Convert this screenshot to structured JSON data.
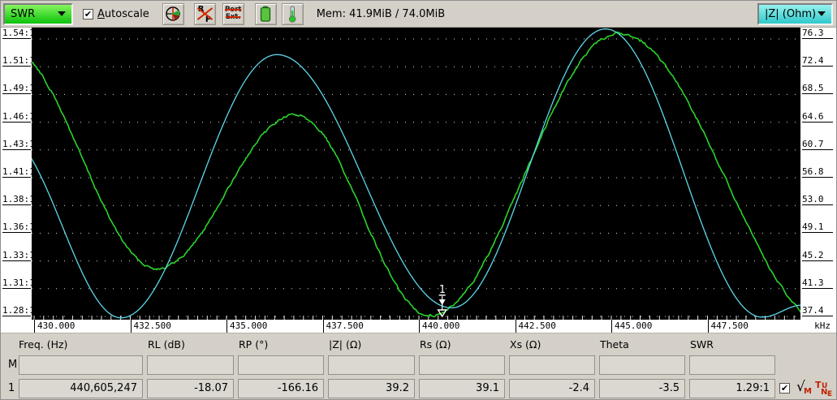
{
  "toolbar": {
    "trace_select_value": "SWR",
    "autoscale_label": "Autoscale",
    "rf_letters": [
      "R",
      "F"
    ],
    "port_ext_lines": [
      "Port",
      "Ext."
    ],
    "mem_text": "Mem: 41.9MiB / 74.0MiB",
    "imp_select_value": "|Z| (Ohm)"
  },
  "chart_data": {
    "type": "line",
    "background": "#000000",
    "grid": "dotted-horizontal",
    "x_axis": {
      "unit_label": "kHz",
      "tick_labels": [
        "430.000",
        "432.500",
        "435.000",
        "437.500",
        "440.000",
        "442.500",
        "445.000",
        "447.500"
      ],
      "tick_values": [
        430,
        432.5,
        435,
        437.5,
        440,
        442.5,
        445,
        447.5
      ],
      "range": [
        429.93,
        449.97
      ],
      "minor_step": 0.25
    },
    "y_left": {
      "label": "SWR",
      "tick_labels": [
        "1.54:1",
        "1.51:1",
        "1.49:1",
        "1.46:1",
        "1.43:1",
        "1.41:1",
        "1.38:1",
        "1.36:1",
        "1.33:1",
        "1.31:1",
        "1.28:1"
      ],
      "range": [
        1.28,
        1.54
      ]
    },
    "y_right": {
      "label": "|Z| (Ohm)",
      "tick_labels": [
        "76.3",
        "72.4",
        "68.5",
        "64.6",
        "60.7",
        "56.8",
        "53.0",
        "49.1",
        "45.2",
        "41.3",
        "37.4"
      ],
      "range": [
        37.4,
        76.3
      ]
    },
    "series": [
      {
        "name": "SWR",
        "color": "#2bd42b",
        "axis": "left",
        "noisy": true,
        "points": [
          [
            429.3,
            1.532
          ],
          [
            433.2,
            1.325
          ],
          [
            436.8,
            1.469
          ],
          [
            440.3,
            1.281
          ],
          [
            445.2,
            1.545
          ],
          [
            450.8,
            1.268
          ]
        ]
      },
      {
        "name": "|Z|",
        "color": "#5cd9e8",
        "axis": "right",
        "noisy": false,
        "points": [
          [
            429.2,
            63.0
          ],
          [
            432.26,
            37.2
          ],
          [
            436.31,
            74.1
          ],
          [
            440.85,
            38.6
          ],
          [
            444.85,
            77.7
          ],
          [
            448.92,
            37.3
          ],
          [
            449.97,
            39.0
          ]
        ]
      }
    ],
    "marker": {
      "id": "1",
      "freq_mhz": 440.605
    }
  },
  "table": {
    "headers": [
      "Freq. (Hz)",
      "RL (dB)",
      "RP (°)",
      "|Z| (Ω)",
      "Rs (Ω)",
      "Xs (Ω)",
      "Theta",
      "SWR"
    ],
    "rows": [
      {
        "label": "M",
        "values": [
          "",
          "",
          "",
          "",
          "",
          "",
          "",
          ""
        ]
      },
      {
        "label": "1",
        "values": [
          "440,605,247",
          "-18.07",
          "-166.16",
          "39.2",
          "39.1",
          "-2.4",
          "-3.5",
          "1.29:1"
        ]
      }
    ]
  },
  "row_actions": {
    "checkbox_checked": "✔",
    "sqrt_symbol": "√",
    "sqrt_sub": "M",
    "tune_letters": [
      "T",
      "U",
      "N",
      "E"
    ]
  },
  "glyphs": {
    "check": "✔"
  }
}
